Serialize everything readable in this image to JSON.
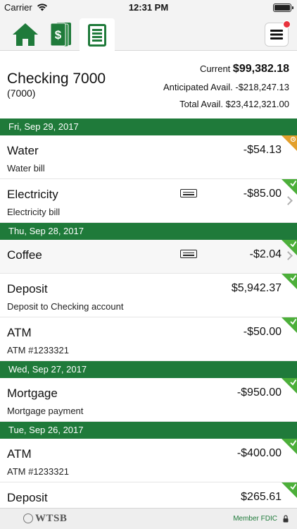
{
  "status_bar": {
    "carrier": "Carrier",
    "time": "12:31 PM"
  },
  "tabs": [
    {
      "icon": "home-icon",
      "selected": false
    },
    {
      "icon": "money-icon",
      "selected": false
    },
    {
      "icon": "register-icon",
      "selected": true
    }
  ],
  "menu": {
    "icon": "hamburger-icon",
    "notification": true
  },
  "account": {
    "name": "Checking 7000",
    "number": "(7000)",
    "current_label": "Current",
    "current_value": "$99,382.18",
    "anticipated_label": "Anticipated Avail.",
    "anticipated_value": "-$218,247.13",
    "total_label": "Total Avail.",
    "total_value": "$23,412,321.00"
  },
  "dates": [
    "Fri, Sep 29, 2017",
    "Thu, Sep 28, 2017",
    "Wed, Sep 27, 2017",
    "Tue, Sep 26, 2017"
  ],
  "transactions": [
    {
      "title": "Water",
      "subtitle": "Water bill",
      "amount": "-$54.13",
      "status": "pending"
    },
    {
      "title": "Electricity",
      "subtitle": "Electricity bill",
      "amount": "-$85.00",
      "status": "cleared",
      "memo": true,
      "chevron": true
    },
    {
      "title": "Coffee",
      "subtitle": "",
      "amount": "-$2.04",
      "status": "cleared",
      "memo": true,
      "chevron": true
    },
    {
      "title": "Deposit",
      "subtitle": "Deposit to Checking account",
      "amount": "$5,942.37",
      "status": "cleared"
    },
    {
      "title": "ATM",
      "subtitle": "ATM #1233321",
      "amount": "-$50.00",
      "status": "cleared"
    },
    {
      "title": "Mortgage",
      "subtitle": "Mortgage payment",
      "amount": "-$950.00",
      "status": "cleared"
    },
    {
      "title": "ATM",
      "subtitle": "ATM #1233321",
      "amount": "-$400.00",
      "status": "cleared"
    },
    {
      "title": "Deposit",
      "subtitle": "",
      "amount": "$265.61",
      "status": "cleared"
    }
  ],
  "footer": {
    "logo": "WTSB",
    "fdic": "Member FDIC"
  },
  "colors": {
    "brand_green": "#1f7a3a",
    "cleared_green": "#4caf3a",
    "pending_orange": "#e3a02c"
  }
}
